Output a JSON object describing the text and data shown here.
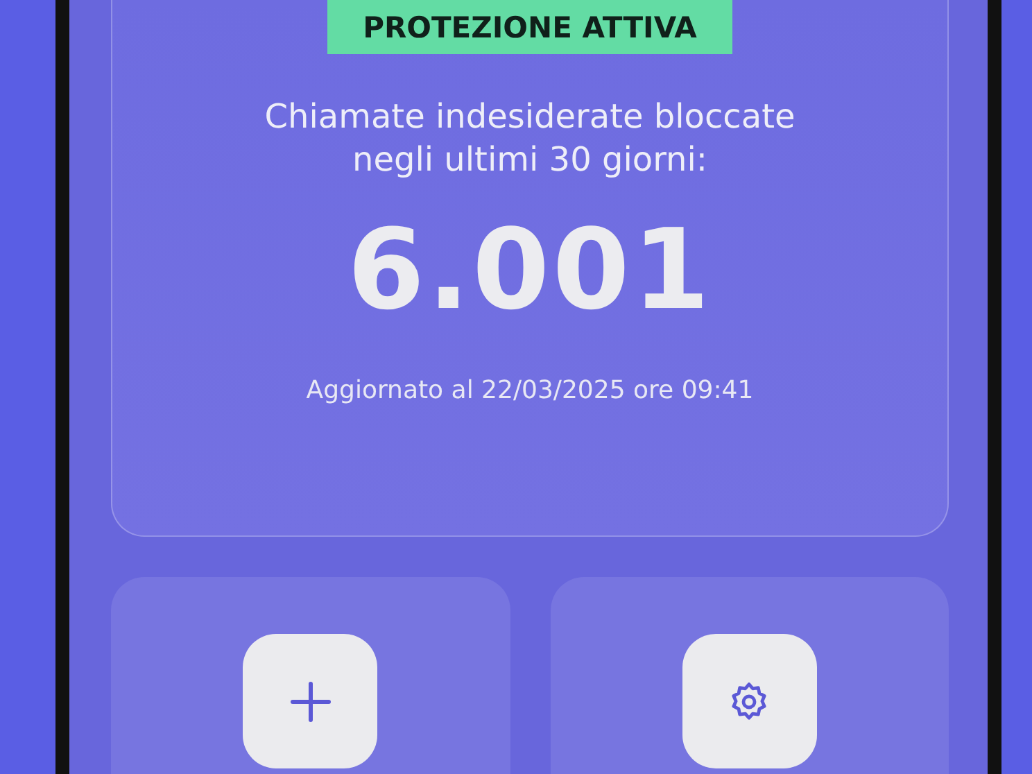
{
  "status_badge": "PROTEZIONE ATTIVA",
  "summary": {
    "caption": "Chiamate indesiderate bloccate negli ultimi 30 giorni:",
    "count": "6.001",
    "updated": "Aggiornato al 22/03/2025 ore 09:41"
  },
  "actions": [
    {
      "kind": "add"
    },
    {
      "kind": "settings"
    }
  ]
}
